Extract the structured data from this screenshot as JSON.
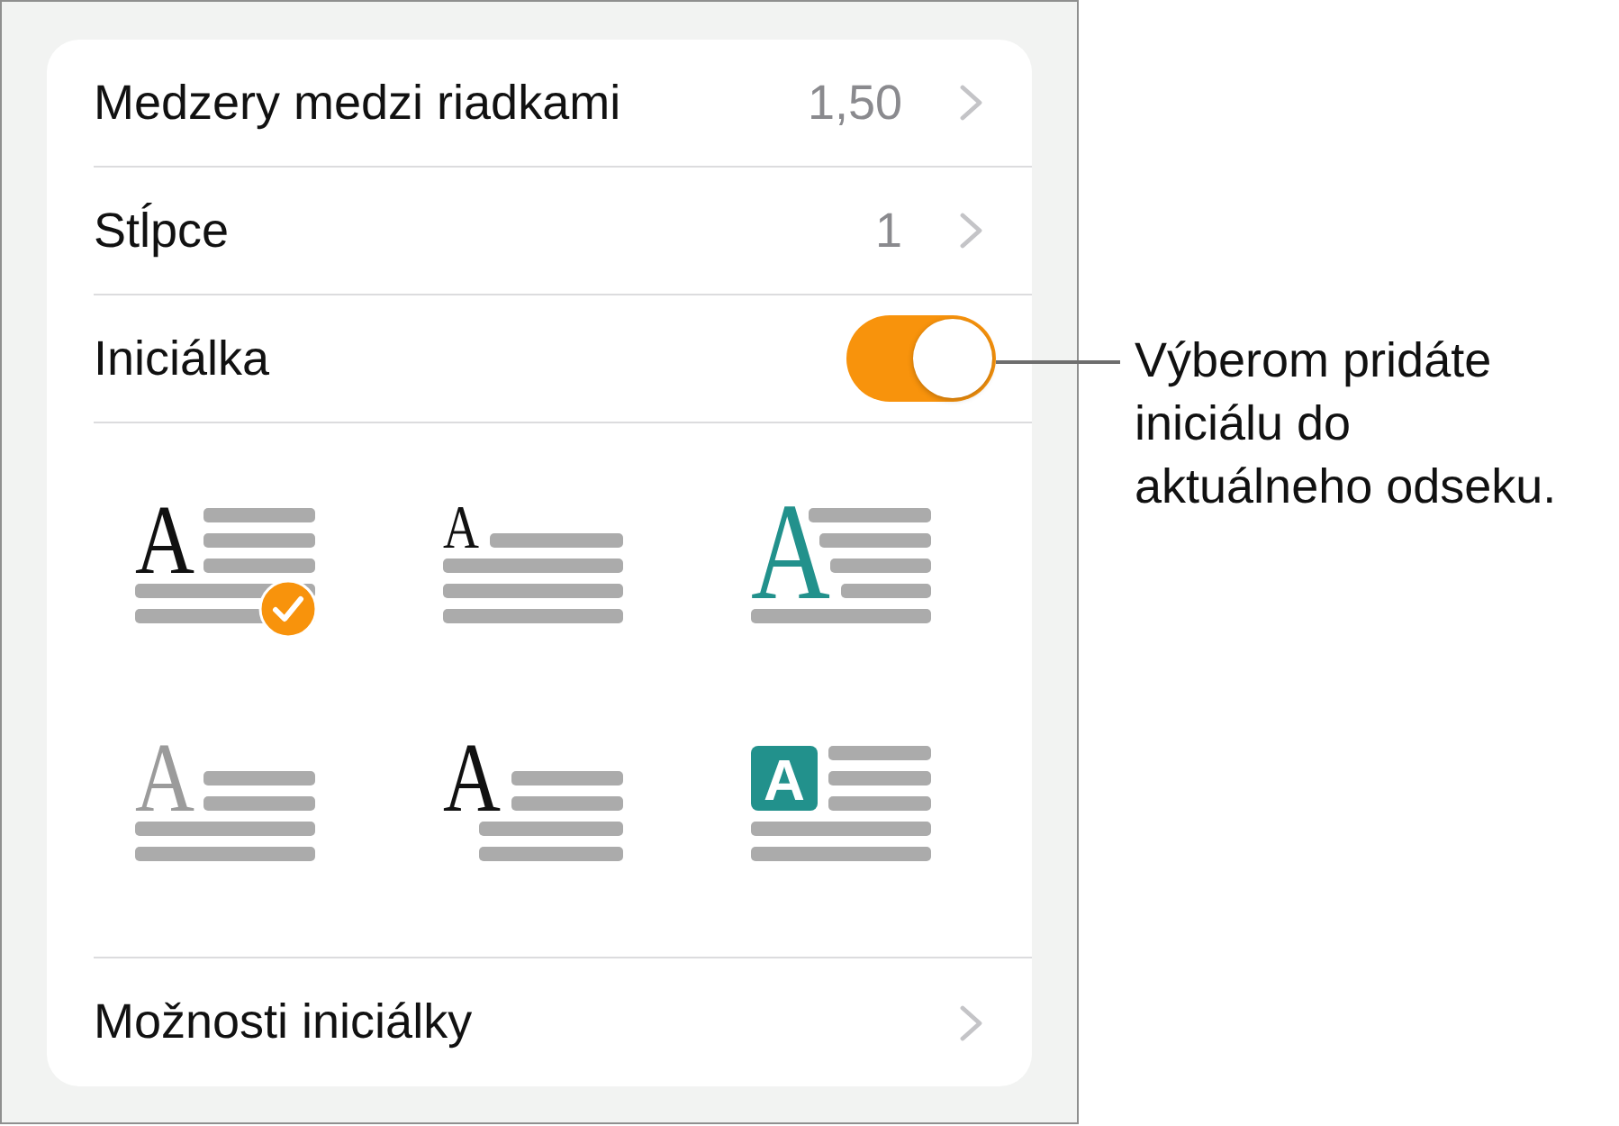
{
  "settings_rows": [
    {
      "kind": "value",
      "label": "Medzery medzi riadkami",
      "value": "1,50"
    },
    {
      "kind": "value",
      "label": "Stĺpce",
      "value": "1"
    },
    {
      "kind": "toggle",
      "label": "Iniciálka",
      "on": true
    }
  ],
  "drop_cap_styles": [
    {
      "kind": "drop",
      "letter": "A",
      "selected": true
    },
    {
      "kind": "raised",
      "letter": "A",
      "selected": false
    },
    {
      "kind": "drop-slant",
      "letter": "A",
      "selected": false
    },
    {
      "kind": "raised-light",
      "letter": "A",
      "selected": false
    },
    {
      "kind": "outdent",
      "letter": "A",
      "selected": false
    },
    {
      "kind": "boxed",
      "letter": "A",
      "selected": false
    }
  ],
  "footer_row": {
    "label": "Možnosti iniciálky"
  },
  "callout": {
    "text": "Výberom pridáte iniciálu do aktuálneho odseku."
  }
}
